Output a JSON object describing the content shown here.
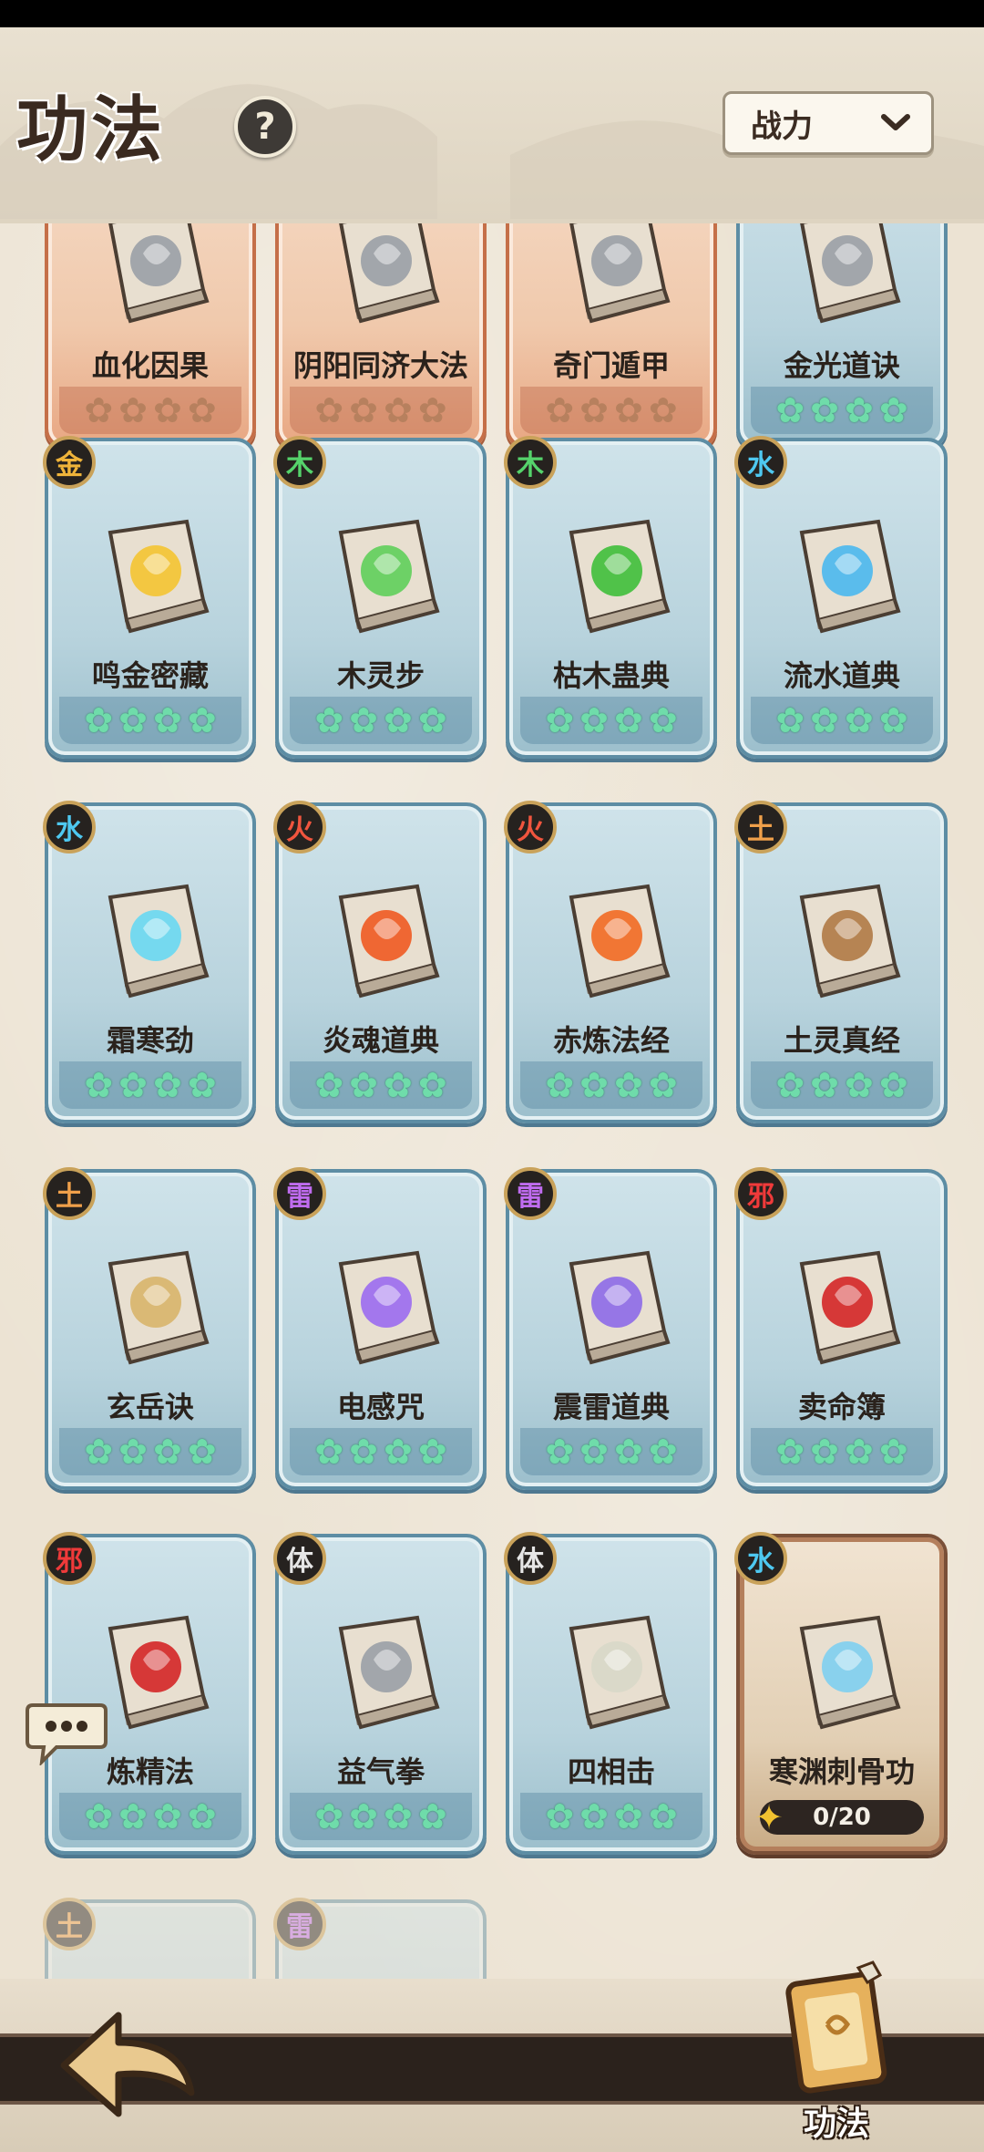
{
  "header": {
    "title": "功法",
    "help": "?",
    "sort_label": "战力"
  },
  "colors": {
    "accent_star": "#6fdcaa",
    "card_blue": "#b8d3dd",
    "card_orange": "#f0c9ac"
  },
  "rows": [
    [
      {
        "name": "血化因果",
        "style": "orange",
        "element": "",
        "ec": "",
        "icon": "red-emblem-icon"
      },
      {
        "name": "阴阳同济大法",
        "style": "orange",
        "element": "",
        "ec": "",
        "icon": "red-emblem-icon"
      },
      {
        "name": "奇门遁甲",
        "style": "orange",
        "element": "",
        "ec": "",
        "icon": "grey-emblem-icon"
      },
      {
        "name": "金光道诀",
        "style": "blue",
        "element": "",
        "ec": "",
        "icon": "book-icon"
      }
    ],
    [
      {
        "name": "鸣金密藏",
        "style": "blue",
        "element": "金",
        "ec": "#f0b43a",
        "icon": "gold-shield-icon",
        "ic": "#f4c431"
      },
      {
        "name": "木灵步",
        "style": "blue",
        "element": "木",
        "ec": "#55d36b",
        "icon": "leaf-icon",
        "ic": "#5fcf5a"
      },
      {
        "name": "枯木蛊典",
        "style": "blue",
        "element": "木",
        "ec": "#55d36b",
        "icon": "green-orb-icon",
        "ic": "#3fbf3a"
      },
      {
        "name": "流水道典",
        "style": "blue",
        "element": "水",
        "ec": "#4ec8f0",
        "icon": "water-wave-icon",
        "ic": "#4ab8ee"
      }
    ],
    [
      {
        "name": "霜寒劲",
        "style": "blue",
        "element": "水",
        "ec": "#4ec8f0",
        "icon": "ice-shard-icon",
        "ic": "#68d8f2"
      },
      {
        "name": "炎魂道典",
        "style": "blue",
        "element": "火",
        "ec": "#f0553e",
        "icon": "fire-icon",
        "ic": "#ef5a21"
      },
      {
        "name": "赤炼法经",
        "style": "blue",
        "element": "火",
        "ec": "#f0553e",
        "icon": "flame-claw-icon",
        "ic": "#f26a22"
      },
      {
        "name": "土灵真经",
        "style": "blue",
        "element": "土",
        "ec": "#f0a04a",
        "icon": "rock-icon",
        "ic": "#b07a45"
      }
    ],
    [
      {
        "name": "玄岳诀",
        "style": "blue",
        "element": "土",
        "ec": "#f0a04a",
        "icon": "axe-icon",
        "ic": "#d8b56a"
      },
      {
        "name": "电感咒",
        "style": "blue",
        "element": "雷",
        "ec": "#c06cf0",
        "icon": "lightning-icon",
        "ic": "#9b6cf0"
      },
      {
        "name": "震雷道典",
        "style": "blue",
        "element": "雷",
        "ec": "#c06cf0",
        "icon": "thunder-hand-icon",
        "ic": "#8d6ae8"
      },
      {
        "name": "卖命簿",
        "style": "blue",
        "element": "邪",
        "ec": "#f03a3a",
        "icon": "blood-crystal-icon",
        "ic": "#d42626"
      }
    ],
    [
      {
        "name": "炼精法",
        "style": "blue",
        "element": "邪",
        "ec": "#f03a3a",
        "icon": "blood-swirl-icon",
        "ic": "#d42626"
      },
      {
        "name": "益气拳",
        "style": "blue",
        "element": "体",
        "ec": "#e6e6e6",
        "icon": "fist-icon",
        "ic": "#9aa0a6"
      },
      {
        "name": "四相击",
        "style": "blue",
        "element": "体",
        "ec": "#e6e6e6",
        "icon": "palm-icon",
        "ic": "#d8d8c8"
      },
      {
        "name": "寒渊刺骨功",
        "style": "brown",
        "element": "水",
        "ec": "#4ec8f0",
        "icon": "ice-dragon-icon",
        "ic": "#7ecff0",
        "progress": "0/20"
      }
    ],
    [
      {
        "name": "",
        "style": "faded",
        "element": "土",
        "ec": "#f0a04a",
        "icon": "book-icon"
      },
      {
        "name": "",
        "style": "faded",
        "element": "雷",
        "ec": "#c06cf0",
        "icon": "dragon-icon"
      }
    ]
  ],
  "bottom_nav": {
    "active_label": "功法"
  }
}
